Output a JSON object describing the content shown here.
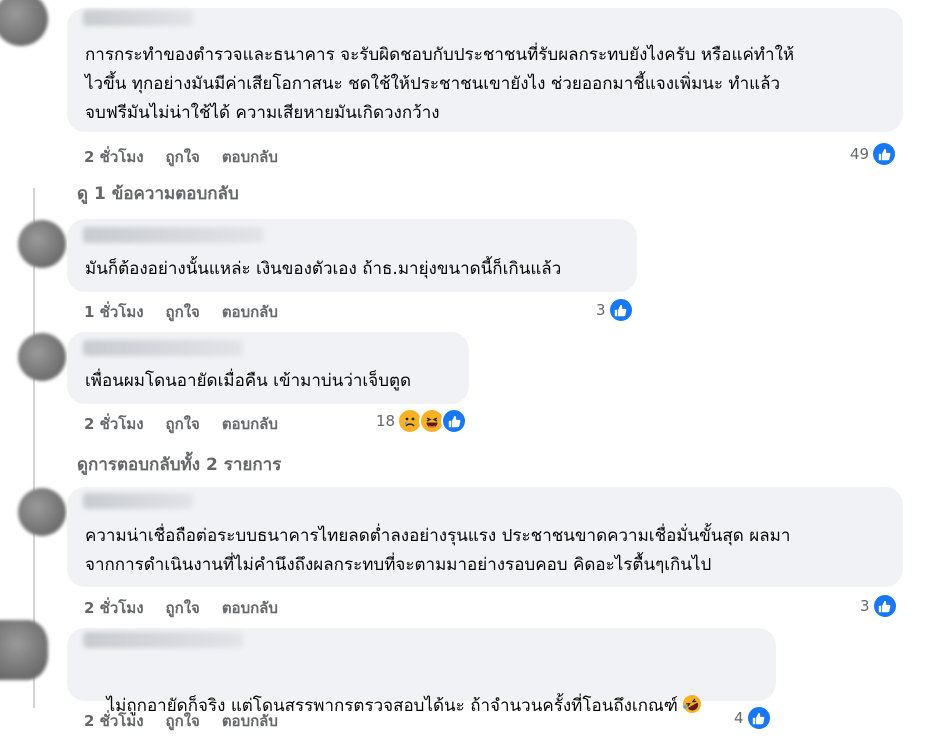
{
  "comments": [
    {
      "text": "การกระทำของตำรวจและธนาคาร จะรับผิดชอบกับประชาชนที่รับผลกระทบยังไงครับ หรือแค่ทำให้\nไวขึ้น ทุกอย่างมันมีค่าเสียโอกาสนะ ชดใช้ให้ประชาชนเขายังไง ช่วยออกมาชี้แจงเพิ่มนะ ทำแล้ว\nจบฟรีมันไม่น่าใช้ได้ ความเสียหายมันเกิดวงกว้าง",
      "time": "2 ชั่วโมง",
      "like": "ถูกใจ",
      "reply": "ตอบกลับ",
      "reaction_count": "49",
      "reactions": [
        "like-icon"
      ]
    },
    {
      "text": "มันก็ต้องอย่างนั้นแหล่ะ เงินของตัวเอง ถ้าธ.มายุ่งขนาดนี้ก็เกินแล้ว",
      "time": "1 ชั่วโมง",
      "like": "ถูกใจ",
      "reply": "ตอบกลับ",
      "reaction_count": "3",
      "reactions": [
        "like-icon"
      ]
    },
    {
      "text": "เพื่อนผมโดนอายัดเมื่อคืน เข้ามาบ่นว่าเจ็บตูด",
      "time": "2 ชั่วโมง",
      "like": "ถูกใจ",
      "reply": "ตอบกลับ",
      "reaction_count": "18",
      "reactions": [
        "sad-icon",
        "haha-icon",
        "like-icon"
      ]
    },
    {
      "text": "ความน่าเชื่อถือต่อระบบธนาคารไทยลดต่ำลงอย่างรุนแรง ประชาชนขาดความเชื่อมั่นขั้นสุด ผลมา\nจากการดำเนินงานที่ไม่คำนึงถึงผลกระทบที่จะตามมาอย่างรอบคอบ คิดอะไรตื้นๆเกินไป",
      "time": "2 ชั่วโมง",
      "like": "ถูกใจ",
      "reply": "ตอบกลับ",
      "reaction_count": "3",
      "reactions": [
        "like-icon"
      ]
    },
    {
      "text": "ไม่ถูกอายัดก็จริง แต่โดนสรรพากรตรวจสอบได้นะ ถ้าจำนวนครั้งที่โอนถึงเกณฑ์",
      "emoji": "rofl-emoji",
      "time": "2 ชั่วโมง",
      "like": "ถูกใจ",
      "reply": "ตอบกลับ",
      "reaction_count": "4",
      "reactions": [
        "like-icon"
      ]
    }
  ],
  "view_replies": [
    "ดู 1 ข้อความตอบกลับ",
    "ดูการตอบกลับทั้ง 2 รายการ"
  ],
  "colors": {
    "bubble": "#f0f2f5",
    "meta": "#65676b",
    "like_blue": "#1877f2",
    "emoji_yellow": "#f7b125"
  }
}
